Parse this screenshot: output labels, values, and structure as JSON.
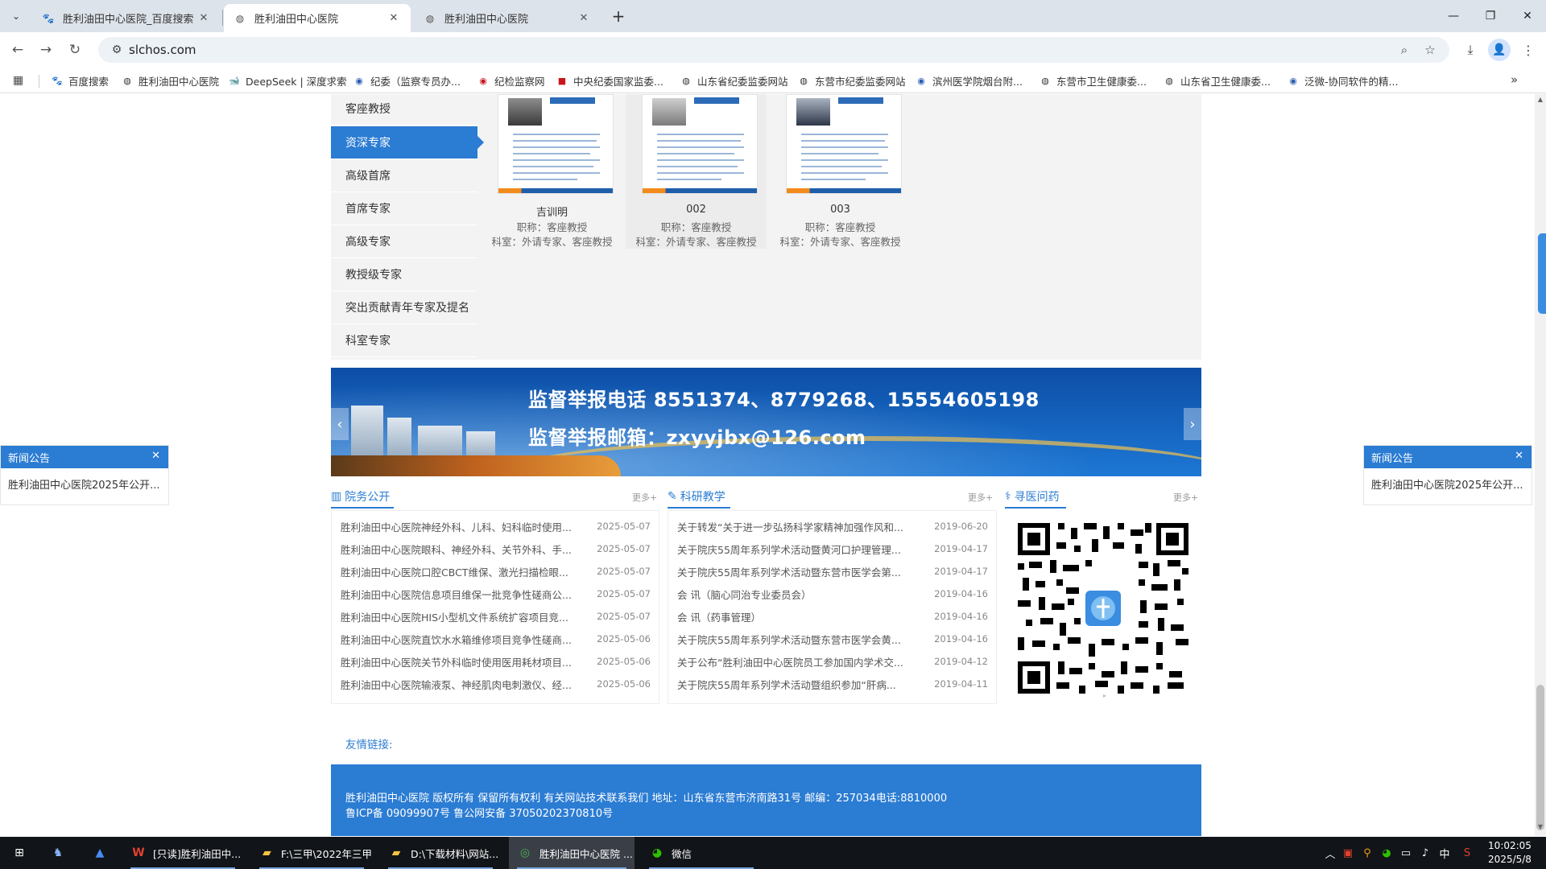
{
  "browser": {
    "tabs": [
      {
        "title": "胜利油田中心医院_百度搜索",
        "icon": "baidu-paw-icon",
        "active": false
      },
      {
        "title": "胜利油田中心医院",
        "icon": "globe-icon",
        "active": true
      },
      {
        "title": "胜利油田中心医院",
        "icon": "globe-icon",
        "active": false
      }
    ],
    "url": "slchos.com",
    "bookmarks": [
      {
        "label": "百度搜索",
        "icon": "baidu-paw-icon"
      },
      {
        "label": "胜利油田中心医院",
        "icon": "globe-icon"
      },
      {
        "label": "DeepSeek | 深度求索",
        "icon": "deepseek-whale-icon"
      },
      {
        "label": "纪委（监察专员办...",
        "icon": "site-icon"
      },
      {
        "label": "纪检监察网",
        "icon": "red-emblem-icon"
      },
      {
        "label": "中央纪委国家监委...",
        "icon": "red-square-icon"
      },
      {
        "label": "山东省纪委监委网站",
        "icon": "globe-icon"
      },
      {
        "label": "东营市纪委监委网站",
        "icon": "globe-icon"
      },
      {
        "label": "滨州医学院烟台附...",
        "icon": "site-icon"
      },
      {
        "label": "东营市卫生健康委...",
        "icon": "globe-icon"
      },
      {
        "label": "山东省卫生健康委...",
        "icon": "globe-icon"
      },
      {
        "label": "泛微-协同软件的精...",
        "icon": "site-icon"
      }
    ]
  },
  "side_menu": {
    "items": [
      {
        "label": "客座教授",
        "active": false
      },
      {
        "label": "资深专家",
        "active": true
      },
      {
        "label": "高级首席",
        "active": false
      },
      {
        "label": "首席专家",
        "active": false
      },
      {
        "label": "高级专家",
        "active": false
      },
      {
        "label": "教授级专家",
        "active": false
      },
      {
        "label": "突出贡献青年专家及提名",
        "active": false
      },
      {
        "label": "科室专家",
        "active": false
      }
    ]
  },
  "experts": [
    {
      "name": "吉训明",
      "title": "职称：客座教授",
      "dept": "科室：外请专家、客座教授"
    },
    {
      "name": "002",
      "title": "职称：客座教授",
      "dept": "科室：外请专家、客座教授"
    },
    {
      "name": "003",
      "title": "职称：客座教授",
      "dept": "科室：外请专家、客座教授"
    }
  ],
  "banner": {
    "line1": "监督举报电话 8551374、8779268、15554605198",
    "line2": "监督举报邮箱：zxyyjbx@126.com"
  },
  "columns": [
    {
      "heading": "院务公开",
      "icon": "building-icon",
      "more": "更多+",
      "items": [
        {
          "title": "胜利油田中心医院神经外科、儿科、妇科临时使用...",
          "date": "2025-05-07"
        },
        {
          "title": "胜利油田中心医院眼科、神经外科、关节外科、手...",
          "date": "2025-05-07"
        },
        {
          "title": "胜利油田中心医院口腔CBCT维保、激光扫描检眼...",
          "date": "2025-05-07"
        },
        {
          "title": "胜利油田中心医院信息项目维保一批竞争性磋商公...",
          "date": "2025-05-07"
        },
        {
          "title": "胜利油田中心医院HIS小型机文件系统扩容项目竞...",
          "date": "2025-05-07"
        },
        {
          "title": "胜利油田中心医院直饮水水箱维修项目竞争性磋商...",
          "date": "2025-05-06"
        },
        {
          "title": "胜利油田中心医院关节外科临时使用医用耗材项目...",
          "date": "2025-05-06"
        },
        {
          "title": "胜利油田中心医院输液泵、神经肌肉电刺激仪、经...",
          "date": "2025-05-06"
        }
      ]
    },
    {
      "heading": "科研教学",
      "icon": "pen-icon",
      "more": "更多+",
      "items": [
        {
          "title": "关于转发“关于进一步弘扬科学家精神加强作风和...",
          "date": "2019-06-20"
        },
        {
          "title": "关于院庆55周年系列学术活动暨黄河口护理管理...",
          "date": "2019-04-17"
        },
        {
          "title": "关于院庆55周年系列学术活动暨东营市医学会第...",
          "date": "2019-04-17"
        },
        {
          "title": "会 讯（脑心同治专业委员会）",
          "date": "2019-04-16"
        },
        {
          "title": "会 讯（药事管理）",
          "date": "2019-04-16"
        },
        {
          "title": "关于院庆55周年系列学术活动暨东营市医学会黄...",
          "date": "2019-04-16"
        },
        {
          "title": "关于公布“胜利油田中心医院员工参加国内学术交...",
          "date": "2019-04-12"
        },
        {
          "title": "关于院庆55周年系列学术活动暨组织参加“肝病...",
          "date": "2019-04-11"
        }
      ]
    },
    {
      "heading": "寻医问药",
      "icon": "doctor-icon",
      "more": "更多+"
    }
  ],
  "links_label": "友情链接:",
  "footer": {
    "line1": "胜利油田中心医院 版权所有 保留所有权利 有关网站技术联系我们 地址：山东省东营市济南路31号 邮编：257034电话:8810000",
    "line2": "鲁ICP备 09099907号 鲁公网安备 37050202370810号"
  },
  "notices": {
    "left": {
      "heading": "新闻公告",
      "text": "胜利油田中心医院2025年公开..."
    },
    "right": {
      "heading": "新闻公告",
      "text": "胜利油田中心医院2025年公开..."
    }
  },
  "taskbar": {
    "apps": [
      {
        "label": "[只读]胜利油田中...",
        "icon": "wps-writer-icon"
      },
      {
        "label": "F:\\三甲\\2022年三甲",
        "icon": "folder-icon"
      },
      {
        "label": "D:\\下载材料\\网站...",
        "icon": "folder-icon"
      },
      {
        "label": "胜利油田中心医院 ...",
        "icon": "chrome-icon"
      },
      {
        "label": "微信",
        "icon": "wechat-icon"
      }
    ],
    "ime": "中",
    "time": "10:02:05",
    "date": "2025/5/8"
  },
  "colors": {
    "accent": "#2b7cd3",
    "banner": "#1565c0",
    "tabstrip": "#dde3ea"
  }
}
